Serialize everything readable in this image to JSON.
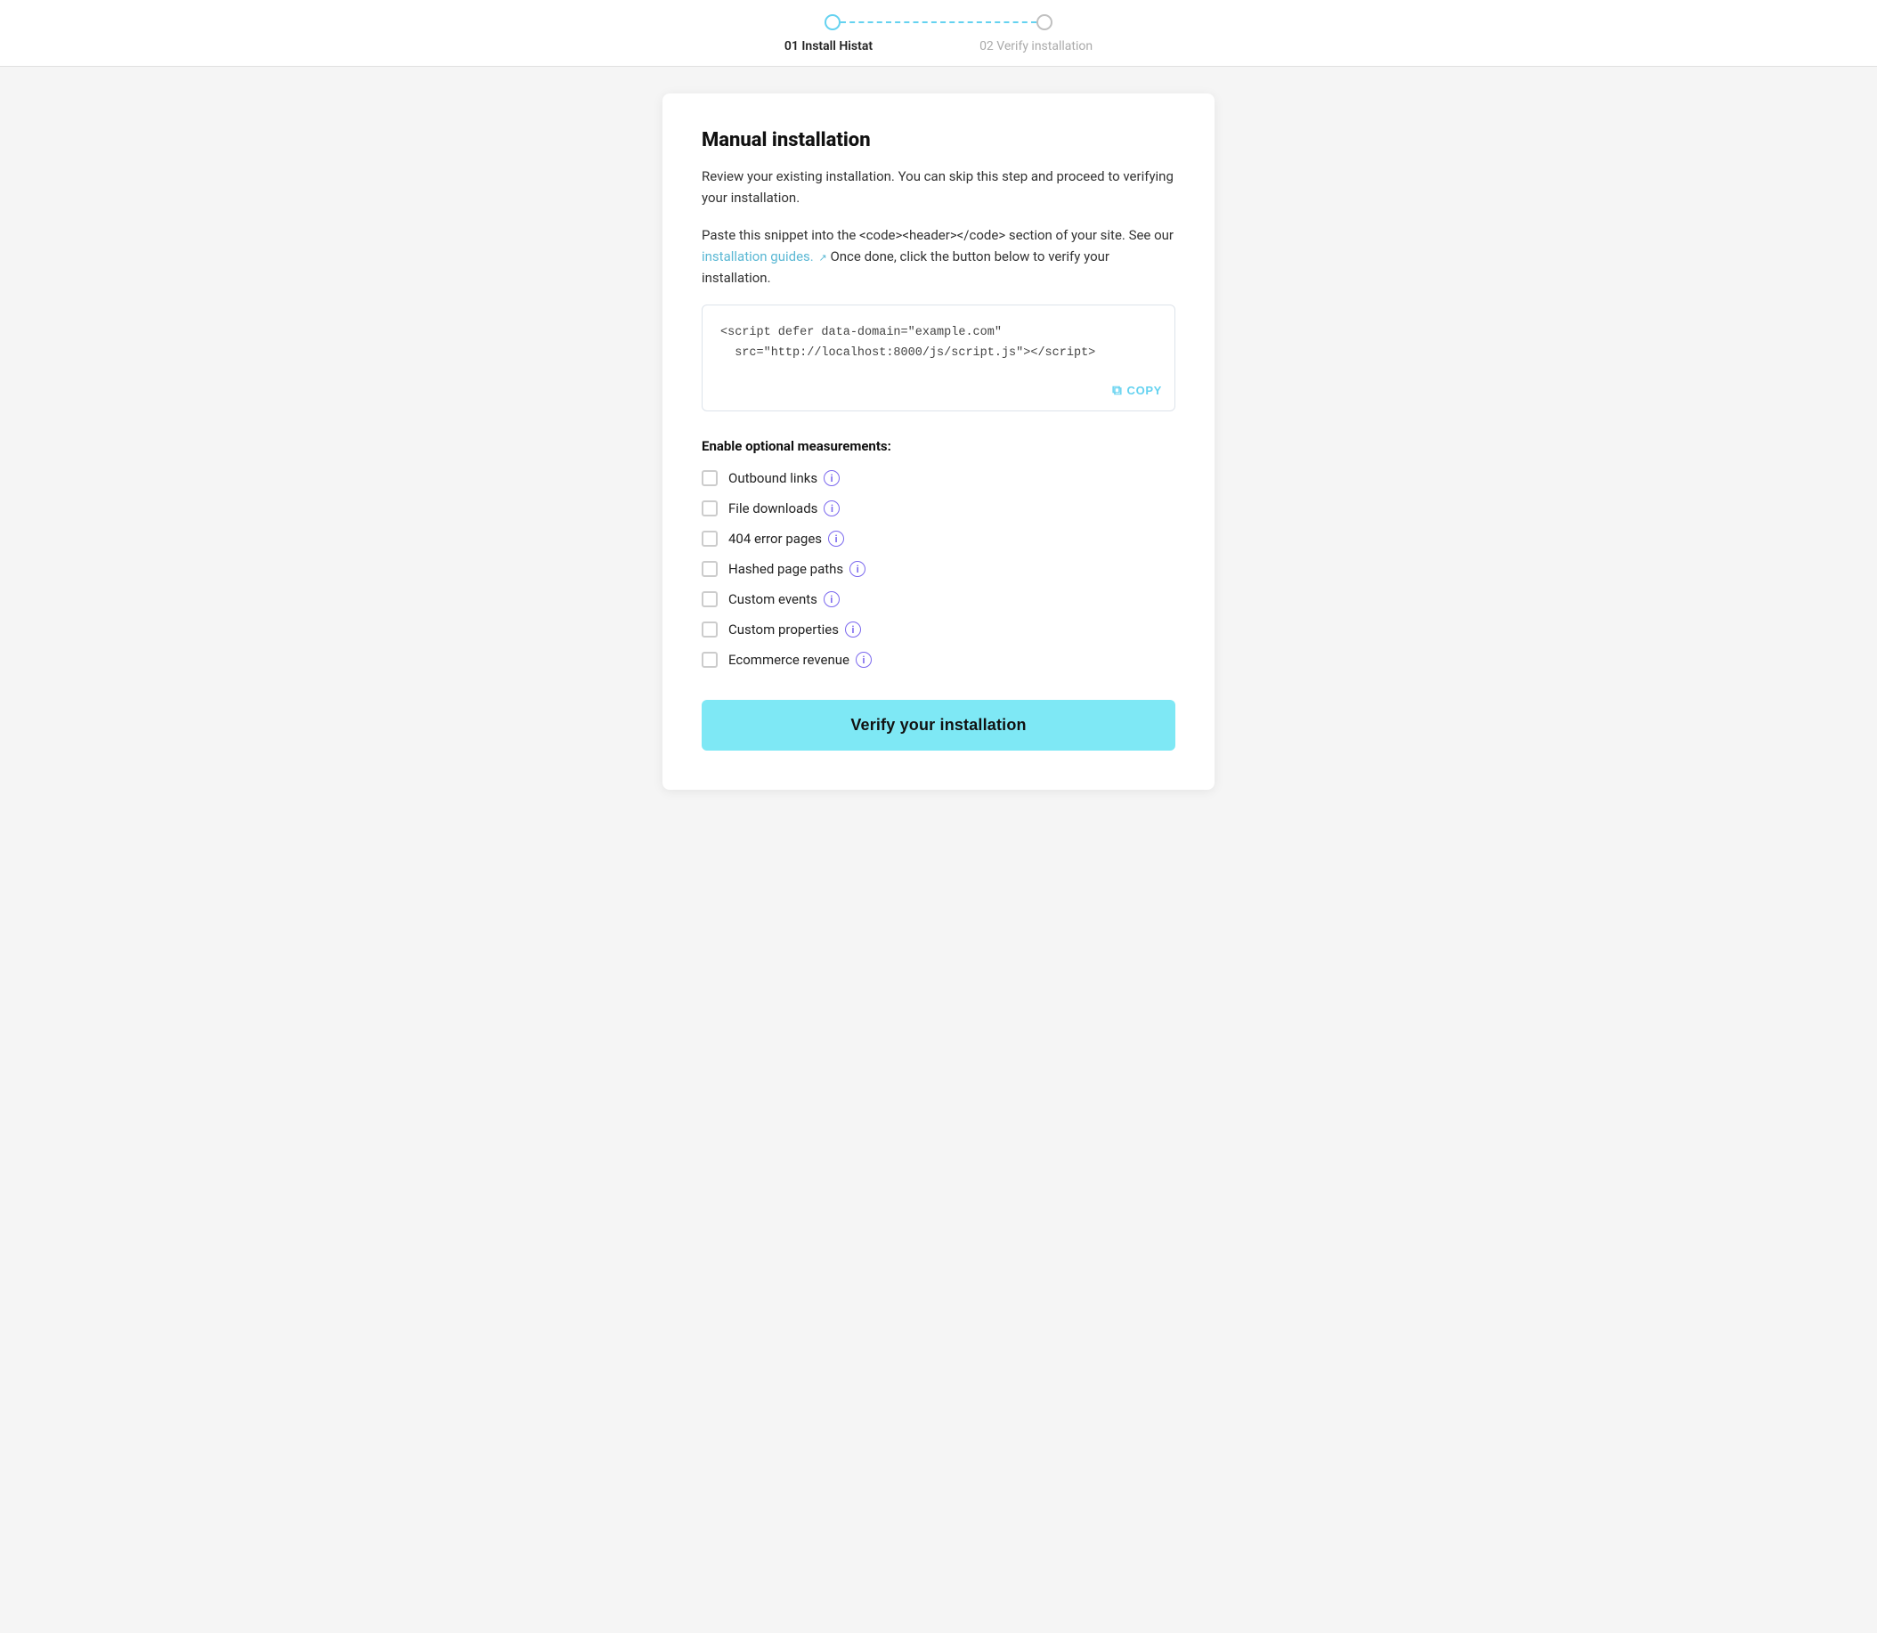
{
  "header": {
    "step1_label": "01 Install Histat",
    "step2_label": "02 Verify installation"
  },
  "main": {
    "title": "Manual installation",
    "description1": "Review your existing installation. You can skip this step and proceed to verifying your installation.",
    "description2_part1": "Paste this snippet into the <code><header></code> section of your site. See our ",
    "description2_link": "installation guides.",
    "description2_part2": " Once done, click the button below to verify your installation.",
    "code_snippet": "<script defer data-domain=\"example.com\"\n  src=\"http://localhost:8000/js/script.js\"></script>",
    "copy_label": "COPY",
    "measurements_title": "Enable optional measurements:",
    "checkboxes": [
      {
        "id": "outbound-links",
        "label": "Outbound links",
        "checked": false
      },
      {
        "id": "file-downloads",
        "label": "File downloads",
        "checked": false
      },
      {
        "id": "error-pages",
        "label": "404 error pages",
        "checked": false
      },
      {
        "id": "hashed-paths",
        "label": "Hashed page paths",
        "checked": false
      },
      {
        "id": "custom-events",
        "label": "Custom events",
        "checked": false
      },
      {
        "id": "custom-properties",
        "label": "Custom properties",
        "checked": false
      },
      {
        "id": "ecommerce-revenue",
        "label": "Ecommerce revenue",
        "checked": false
      }
    ],
    "verify_button_label": "Verify your installation"
  },
  "icons": {
    "copy": "⧉",
    "external_link": "↗",
    "info": "i"
  },
  "colors": {
    "accent": "#64d2f0",
    "info_border": "#7b68ee",
    "verify_bg": "#7ee8f5"
  }
}
